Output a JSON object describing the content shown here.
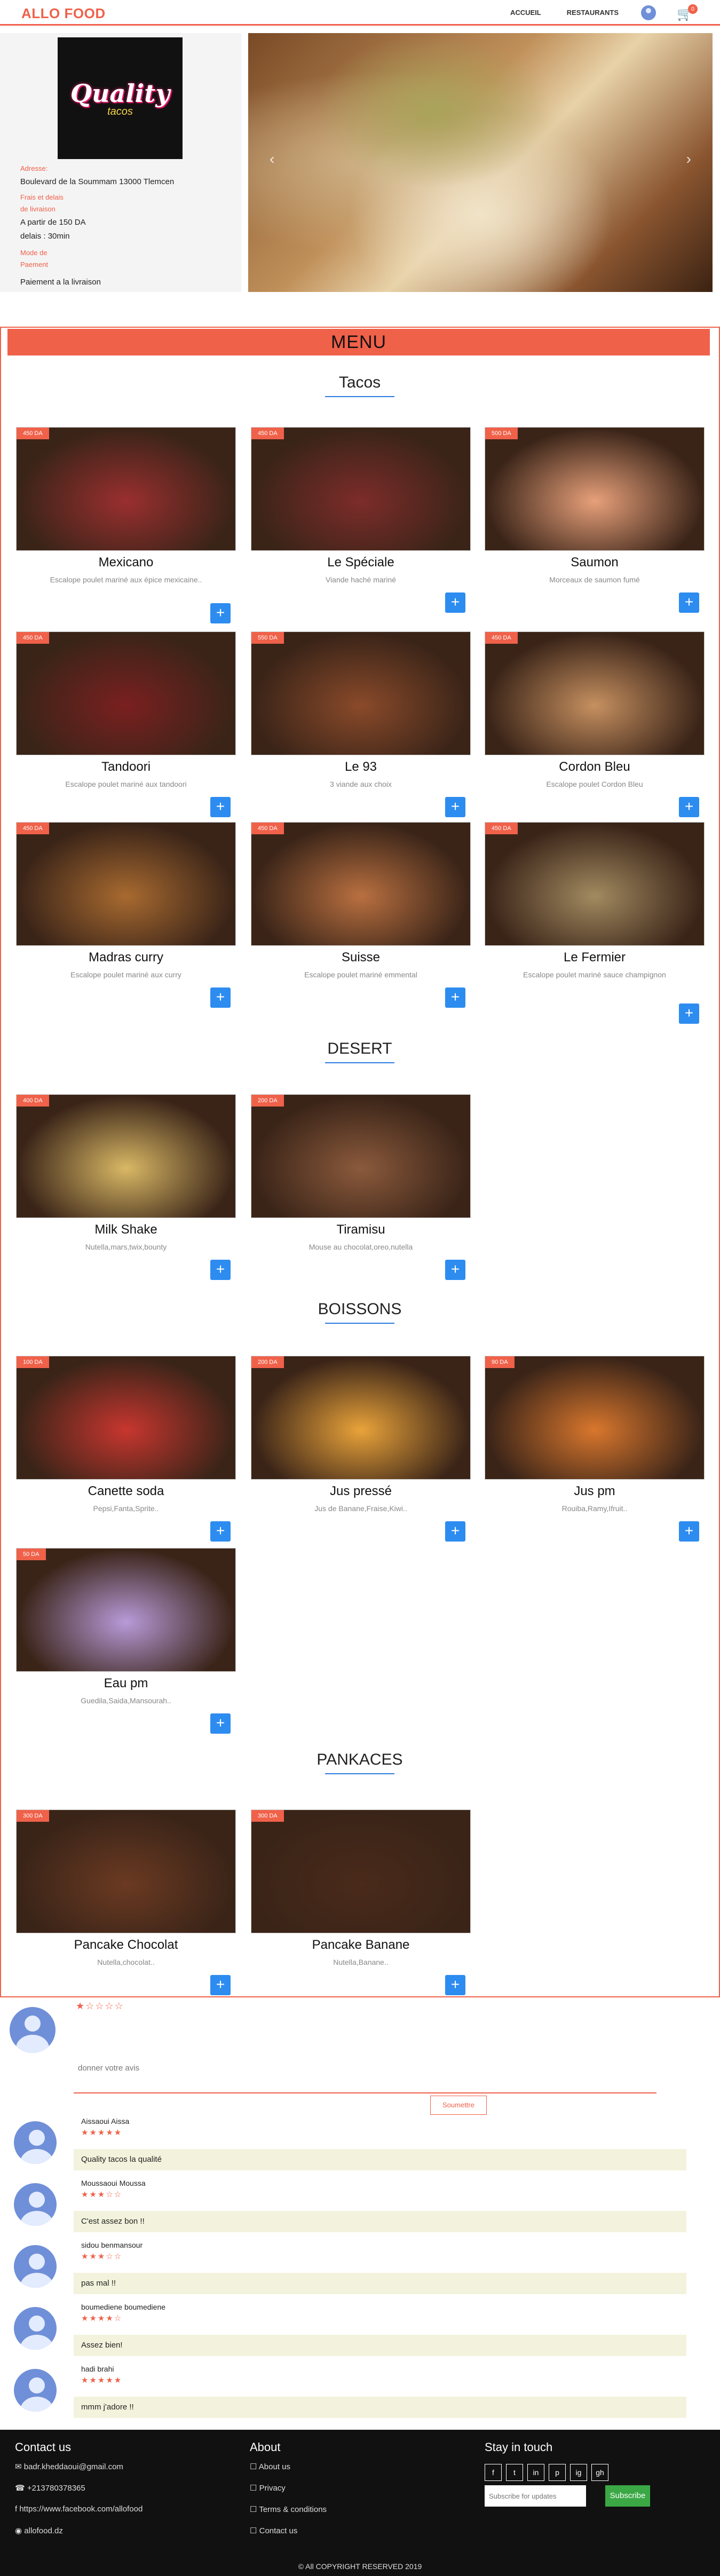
{
  "nav": {
    "brand": "ALLO FOOD",
    "links": [
      "ACCUEIL",
      "RESTAURANTS"
    ],
    "cart_count": "0"
  },
  "restaurant": {
    "logo_text": "Quality",
    "logo_sub": "tacos",
    "address_label": "Adresse:",
    "address": "Boulevard de la Soummam 13000 Tlemcen",
    "fees_label_1": "Frais et delais",
    "fees_label_2": "de livraison",
    "fees": "A partir de 150 DA",
    "delay": "delais : 30min",
    "payment_label_1": "Mode de",
    "payment_label_2": "Paement",
    "payment": "Paiement a la livraison"
  },
  "menu": {
    "title": "MENU",
    "sections": [
      {
        "title": "Tacos"
      },
      {
        "title": "DESERT"
      },
      {
        "title": "BOISSONS"
      },
      {
        "title": "PANKACES"
      }
    ],
    "items": [
      {
        "price": "450 DA",
        "name": "Mexicano",
        "desc": "Escalope poulet mariné aux épice mexicaine..",
        "color": "#9a2f2f"
      },
      {
        "price": "450 DA",
        "name": "Le Spéciale",
        "desc": "Viande haché mariné",
        "color": "#7d2c2a"
      },
      {
        "price": "500 DA",
        "name": "Saumon",
        "desc": "Morceaux de saumon fumé",
        "color": "#e7a07a"
      },
      {
        "price": "450 DA",
        "name": "Tandoori",
        "desc": "Escalope poulet mariné aux tandoori",
        "color": "#7a2020"
      },
      {
        "price": "550 DA",
        "name": "Le 93",
        "desc": "3 viande aux choix",
        "color": "#8a4a2a"
      },
      {
        "price": "450 DA",
        "name": "Cordon Bleu",
        "desc": "Escalope poulet Cordon Bleu",
        "color": "#c69060"
      },
      {
        "price": "450 DA",
        "name": "Madras curry",
        "desc": "Escalope poulet mariné aux curry",
        "color": "#a86a30"
      },
      {
        "price": "450 DA",
        "name": "Suisse",
        "desc": "Escalope poulet mariné emmental",
        "color": "#b97040"
      },
      {
        "price": "450 DA",
        "name": "Le Fermier",
        "desc": "Escalope poulet mariné sauce champignon",
        "color": "#a28a60"
      },
      {
        "price": "400 DA",
        "name": "Milk Shake",
        "desc": "Nutella,mars,twix,bounty",
        "color": "#d9b865"
      },
      {
        "price": "200 DA",
        "name": "Tiramisu",
        "desc": "Mouse au chocolat,oreo,nutella",
        "color": "#8b5a3c"
      },
      {
        "price": "100 DA",
        "name": "Canette soda",
        "desc": "Pepsi,Fanta,Sprite..",
        "color": "#c7362f"
      },
      {
        "price": "200 DA",
        "name": "Jus pressé",
        "desc": "Jus de Banane,Fraise,Kiwi..",
        "color": "#e9a33a"
      },
      {
        "price": "90 DA",
        "name": "Jus pm",
        "desc": "Rouiba,Ramy,Ifruit..",
        "color": "#d9772d"
      },
      {
        "price": "50 DA",
        "name": "Eau pm",
        "desc": "Guedila,Saida,Mansourah..",
        "color": "#b89ad8"
      },
      {
        "price": "300 DA",
        "name": "Pancake Chocolat",
        "desc": "Nutella,chocolat..",
        "color": "#6b3a22"
      },
      {
        "price": "300 DA",
        "name": "Pancake Banane",
        "desc": "Nutella,Banane..",
        "color": "#4a2a1a"
      }
    ]
  },
  "reviews": {
    "new_stars": "★☆☆☆☆",
    "placeholder": "donner votre avis",
    "submit": "Soumettre",
    "list": [
      {
        "name": "Aissaoui Aissa",
        "stars": "★★★★★",
        "text": "Quality tacos la qualité"
      },
      {
        "name": "Moussaoui Moussa",
        "stars": "★★★☆☆",
        "text": "C'est assez bon !!"
      },
      {
        "name": "sidou benmansour",
        "stars": "★★★☆☆",
        "text": "pas mal !!"
      },
      {
        "name": "boumediene boumediene",
        "stars": "★★★★☆",
        "text": "Assez bien!"
      },
      {
        "name": "hadi brahi",
        "stars": "★★★★★",
        "text": "mmm j'adore !!"
      }
    ]
  },
  "footer": {
    "contact_title": "Contact us",
    "email": "badr.kheddaoui@gmail.com",
    "phone": "+213780378365",
    "facebook": "https://www.facebook.com/allofood",
    "site": "allofood.dz",
    "about_title": "About",
    "about_links": [
      "About us",
      "Privacy",
      "Terms & conditions",
      "Contact us"
    ],
    "stay_title": "Stay in touch",
    "social": [
      "f",
      "t",
      "in",
      "p",
      "ig",
      "gh"
    ],
    "subscribe_placeholder": "Subscribe for updates",
    "subscribe_btn": "Subscribe",
    "copyright": "© All COPYRIGHT RESERVED 2019"
  }
}
